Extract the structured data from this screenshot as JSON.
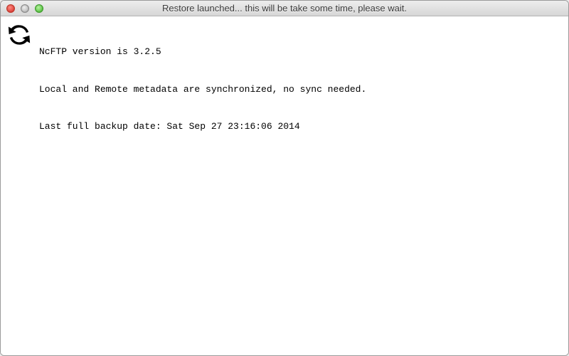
{
  "window": {
    "title": "Restore launched... this will be take some time, please wait."
  },
  "log": {
    "lines": [
      "NcFTP version is 3.2.5",
      "Local and Remote metadata are synchronized, no sync needed.",
      "Last full backup date: Sat Sep 27 23:16:06 2014"
    ]
  }
}
